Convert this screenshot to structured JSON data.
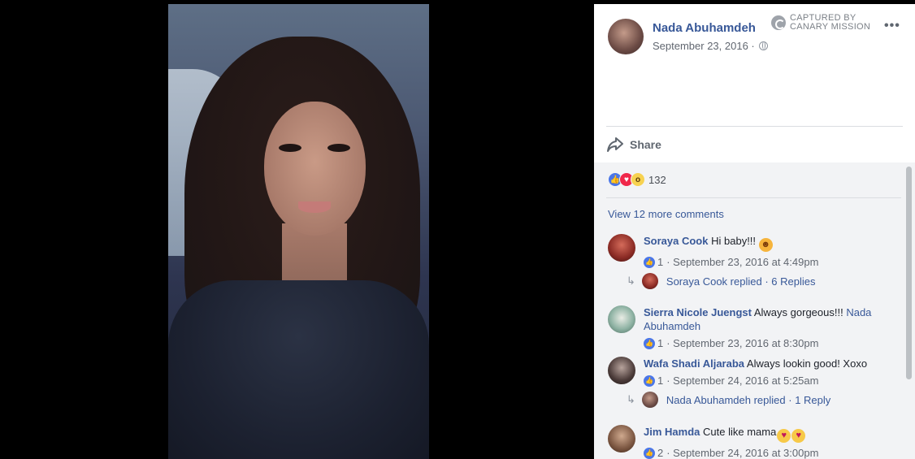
{
  "post": {
    "author": "Nada Abuhamdeh",
    "date": "September 23, 2016 ·",
    "watermark_line1": "CAPTURED BY",
    "watermark_line2": "CANARY MISSION",
    "more_label": "•••",
    "share_label": "Share",
    "reaction_count": "132",
    "view_more": "View 12 more comments"
  },
  "comments": [
    {
      "author": "Soraya Cook",
      "text": "Hi baby!!!",
      "likes": "1",
      "meta": "· September 23, 2016 at 4:49pm",
      "reply_author": "Soraya Cook replied",
      "reply_count": "· 6 Replies"
    },
    {
      "author": "Sierra Nicole Juengst",
      "text": "Always gorgeous!!!",
      "tag": "Nada Abuhamdeh",
      "likes": "1",
      "meta": "· September 23, 2016 at 8:30pm"
    },
    {
      "author": "Wafa Shadi Aljaraba",
      "text": "Always lookin good! Xoxo",
      "likes": "1",
      "meta": "· September 24, 2016 at 5:25am",
      "reply_author": "Nada Abuhamdeh replied",
      "reply_count": "· 1 Reply"
    },
    {
      "author": "Jim Hamda",
      "text": "Cute like mama",
      "likes": "2",
      "meta": "· September 24, 2016 at 3:00pm"
    }
  ],
  "icons": {
    "globe": "globe-icon",
    "share": "share-icon",
    "like": "like-icon",
    "love": "love-icon",
    "wow": "wow-icon"
  },
  "colors": {
    "link": "#385898",
    "like": "#4a76e8",
    "love": "#f0284a",
    "panel_bg": "#f2f3f5"
  }
}
